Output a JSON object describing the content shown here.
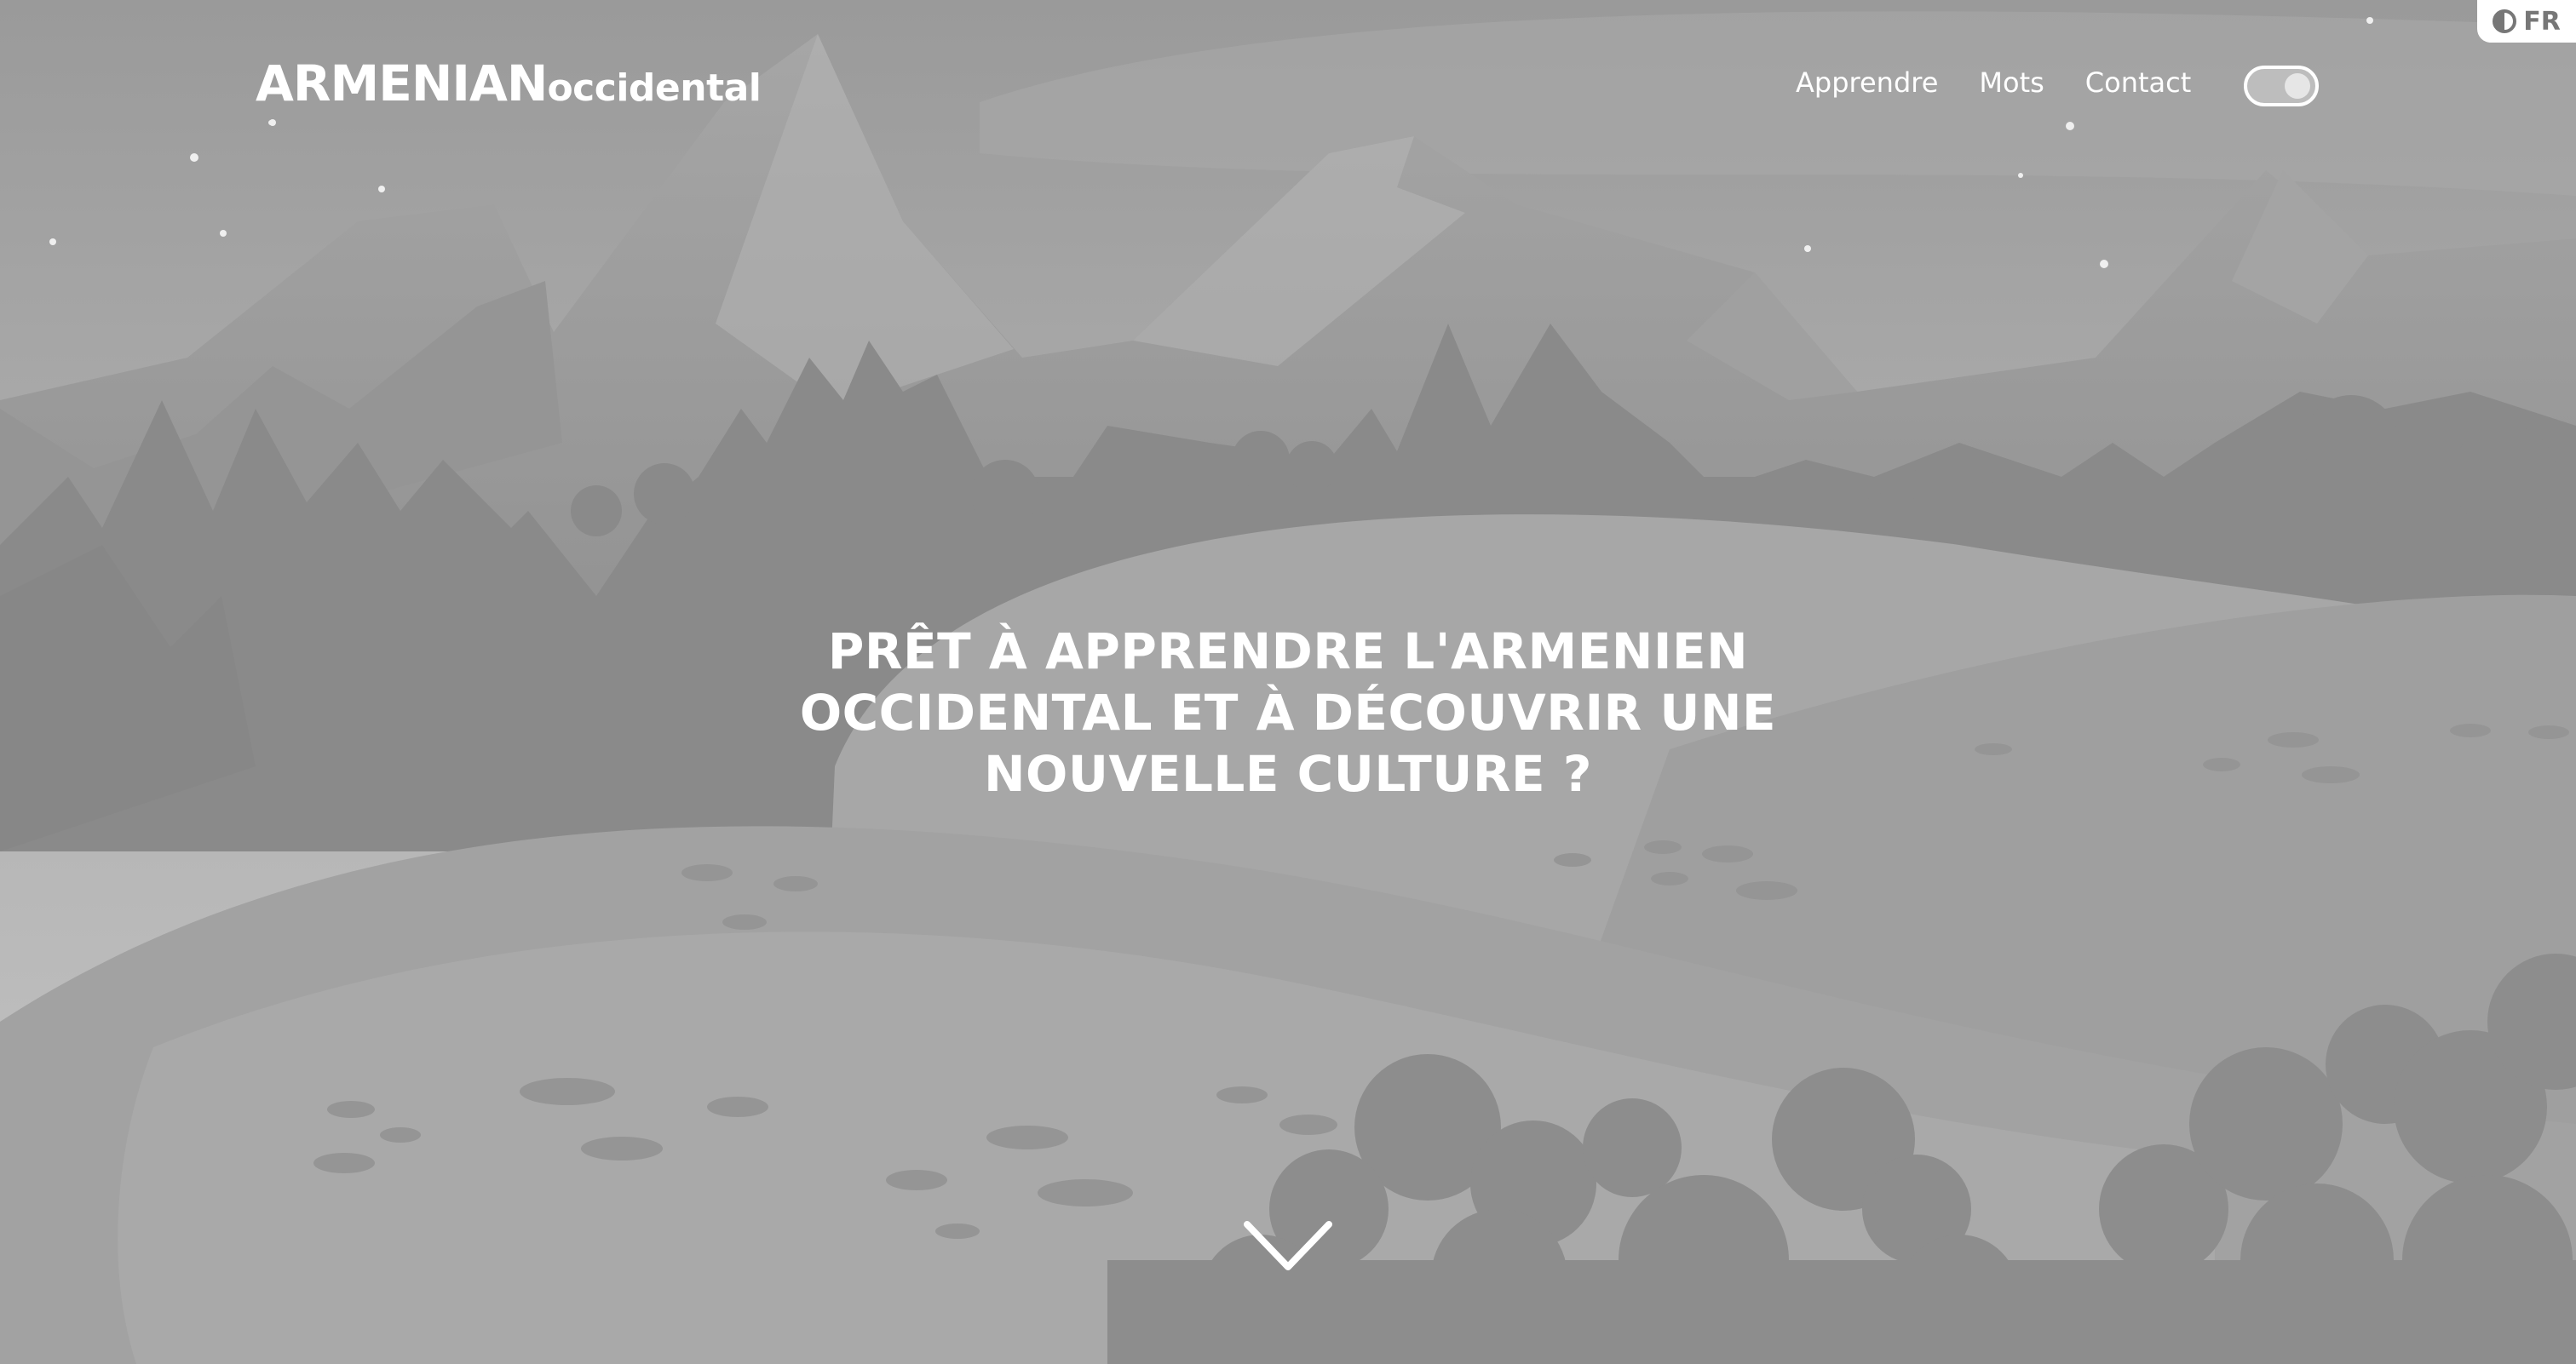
{
  "header": {
    "logo_main": "ARMENIAN",
    "logo_sub": "occidental",
    "nav": [
      {
        "label": "Apprendre"
      },
      {
        "label": "Mots"
      },
      {
        "label": "Contact"
      }
    ],
    "theme_toggle_on": true
  },
  "language": {
    "label": "FR",
    "icon": "flag-icon"
  },
  "hero": {
    "lines": [
      "PRÊT À APPRENDRE L'ARMENIEN",
      "OCCIDENTAL ET À DÉCOUVRIR UNE",
      "NOUVELLE CULTURE ?"
    ]
  },
  "icons": {
    "scroll": "chevron-down-icon",
    "toggle": "toggle-switch-icon"
  },
  "colors": {
    "text": "#ffffff",
    "background": "#9c9c9c"
  }
}
